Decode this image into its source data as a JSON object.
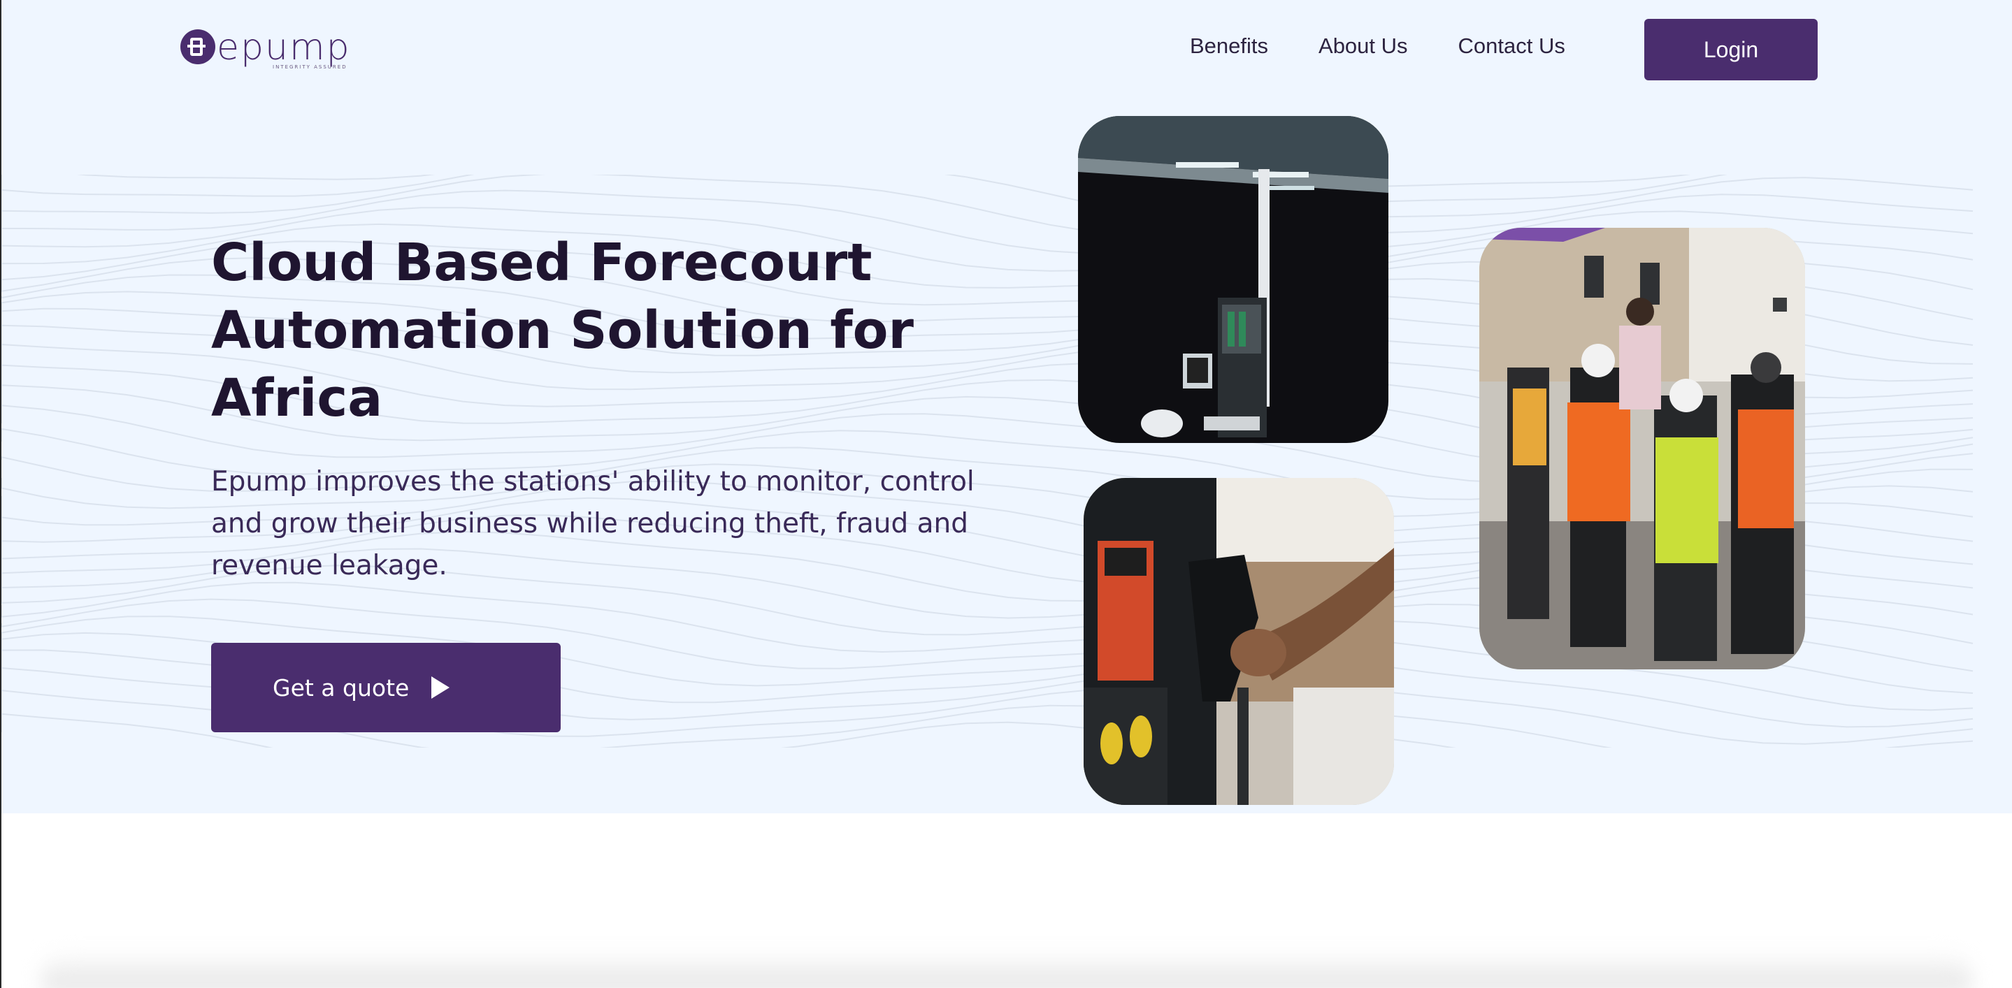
{
  "brand": {
    "name": "epump",
    "tagline": "INTEGRITY ASSURED",
    "color": "#4a2d6e"
  },
  "nav": {
    "links": [
      {
        "label": "Benefits"
      },
      {
        "label": "About Us"
      },
      {
        "label": "Contact Us"
      }
    ],
    "login_label": "Login"
  },
  "hero": {
    "headline": "Cloud Based Forecourt Automation Solution for Africa",
    "subtext": "Epump improves the stations' ability to monitor, control and grow their business while reducing theft, fraud and revenue leakage.",
    "cta_label": "Get a quote",
    "cta_icon": "play-icon",
    "background_color": "#eff6ff"
  },
  "images": [
    {
      "name": "fuel-station-night-photo"
    },
    {
      "name": "fuel-nozzle-hand-photo"
    },
    {
      "name": "workers-safety-vests-photo"
    }
  ]
}
